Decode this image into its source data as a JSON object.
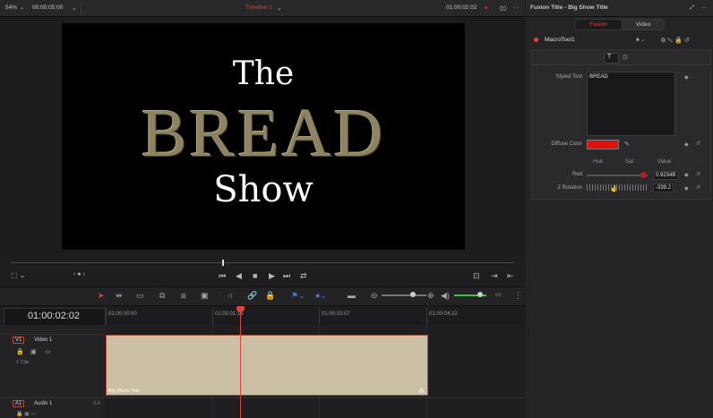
{
  "viewer_bar": {
    "zoom": "54%",
    "source_tc": "00:00:05:00",
    "timeline_name": "Timeline 1",
    "record_tc": "01:00:02:02"
  },
  "viewer": {
    "line1": "The",
    "line2": "BREAD",
    "line3": "Show"
  },
  "timeline": {
    "timecode": "01:00:02:02",
    "ruler": [
      "01:00:00:00",
      "01:00:01:15",
      "01:00:03:07",
      "01:00:04:22"
    ],
    "video_track": {
      "badge": "V1",
      "name": "Video 1",
      "clips": "1 Clip"
    },
    "audio_track": {
      "badge": "A1",
      "name": "Audio 1",
      "level": "2.0"
    },
    "clip_name": "Big Show Title"
  },
  "inspector": {
    "title": "Fusion Title - Big Show Title",
    "tabs": [
      "Fusion",
      "Video"
    ],
    "active_tab": "Fusion",
    "tool_name": "MacroTool1",
    "styled_text_label": "Styled Text",
    "styled_text_value": "BREAD",
    "diffuse_label": "Diffuse Color",
    "diffuse_color": "#e0100e",
    "col_hue": "Hue",
    "col_sat": "Sat",
    "col_value": "Value",
    "red_label": "Red",
    "red_value": "0.9234B",
    "red_level": 0.92,
    "zrot_label": "Z Rotation",
    "zrot_value": "-339.2"
  },
  "colors": {
    "accent_red": "#e0453a",
    "clip_fill": "#cbbfa4",
    "title_gold": "#8f8461"
  }
}
